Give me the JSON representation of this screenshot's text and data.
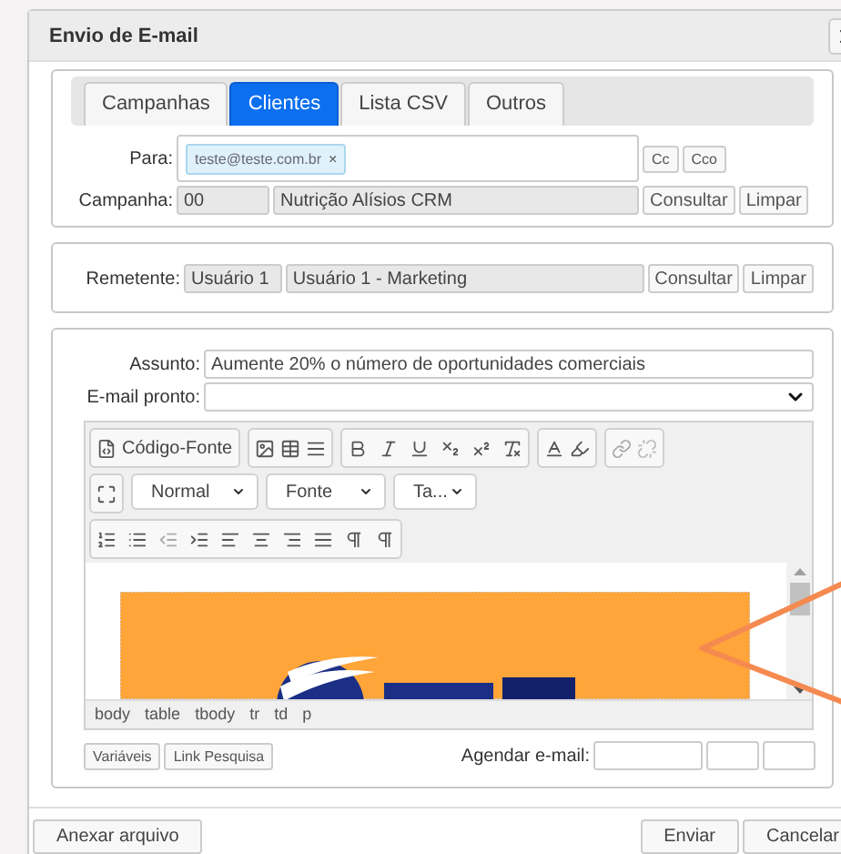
{
  "dialog": {
    "title": "Envio de E-mail"
  },
  "tabs": [
    {
      "label": "Campanhas",
      "selected": false
    },
    {
      "label": "Clientes",
      "selected": true
    },
    {
      "label": "Lista CSV",
      "selected": false
    },
    {
      "label": "Outros",
      "selected": false
    }
  ],
  "para": {
    "label": "Para:",
    "tokens": [
      {
        "text": "teste@teste.com.br",
        "remove": "×"
      }
    ],
    "buttons": [
      "Cc",
      "Cco"
    ]
  },
  "campanha": {
    "label": "Campanha:",
    "code": "00",
    "name": "Nutrição Alísios CRM",
    "buttons": [
      "Consultar",
      "Limpar"
    ]
  },
  "remetente": {
    "label": "Remetente:",
    "code": "Usuário 1",
    "name": "Usuário 1 - Marketing",
    "buttons": [
      "Consultar",
      "Limpar"
    ]
  },
  "assunto": {
    "label": "Assunto:",
    "value": "Aumente 20% o número de oportunidades comerciais"
  },
  "email_pronto": {
    "label": "E-mail pronto:"
  },
  "editor": {
    "source_button": "Código-Fonte",
    "dropdowns": [
      "Normal",
      "Fonte",
      "Ta..."
    ],
    "content": {
      "kind": "picture"
    },
    "path": [
      "body",
      "table",
      "tbody",
      "tr",
      "td",
      "p"
    ]
  },
  "extra_buttons": [
    "Variáveis",
    "Link Pesquisa"
  ],
  "schedule": {
    "label": "Agendar e-mail:"
  },
  "footer": {
    "attach": "Anexar arquivo",
    "actions": [
      "Enviar",
      "Cancelar"
    ]
  }
}
